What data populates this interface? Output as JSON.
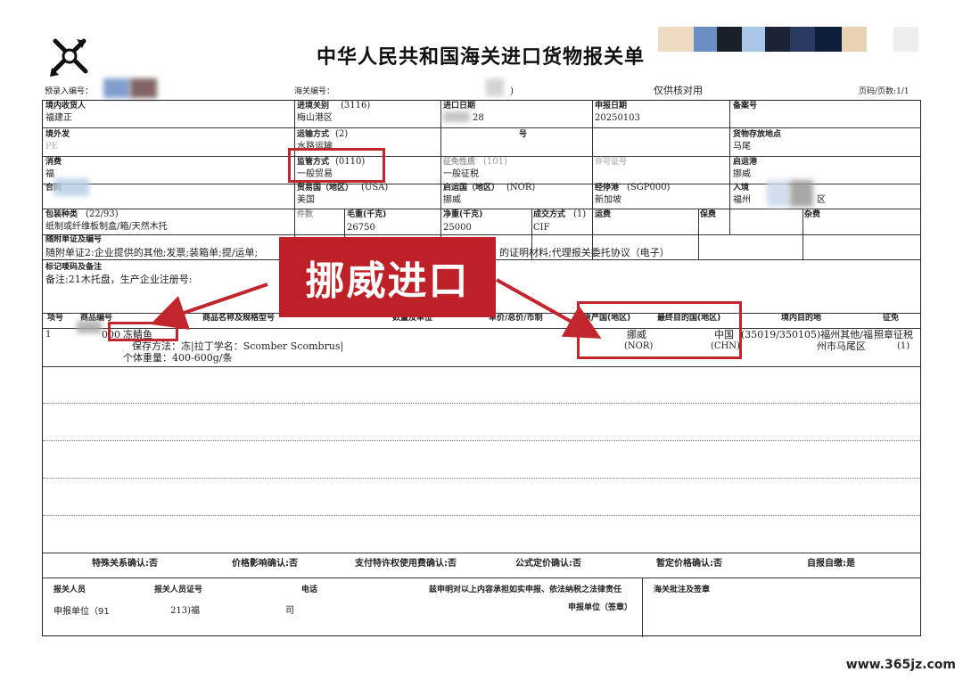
{
  "doc": {
    "title": "中华人民共和国海关进口货物报关单",
    "pre_entry_label": "预录入编号：",
    "customs_no_label": "海关编号：",
    "customs_no_tail": ")",
    "reference": "仅供核对用",
    "page": "页码/页数:1/1"
  },
  "row1": {
    "consignee_label": "境内收货人",
    "consignee_value": "福建正",
    "port_label": "进境关别",
    "port_code": "(3116)",
    "port_value": "梅山港区",
    "import_date_label": "进口日期",
    "import_date_value": "28",
    "declare_date_label": "申报日期",
    "declare_date_value": "20250103",
    "filing_label": "备案号"
  },
  "row2": {
    "shipper_label": "境外发",
    "shipper_value": "PE",
    "transport_label": "运输方式",
    "transport_code": "(2)",
    "transport_value": "水路运输",
    "voyage_label": "号",
    "storage_label": "货物存放地点",
    "storage_value": "马尾"
  },
  "row3": {
    "consumer_label": "消费",
    "consumer_value": "福",
    "supervision_label": "监管方式",
    "supervision_code": "(0110)",
    "supervision_value": "一般贸易",
    "levy_label": "征免性质",
    "levy_code": "(101)",
    "levy_value": "一般征税",
    "license_label": "许可证号",
    "departure_label": "启运港",
    "departure_value": "挪威"
  },
  "row4": {
    "contract_label": "合同",
    "trade_country_label": "贸易国（地区）",
    "trade_country_code": "(USA)",
    "trade_country_value": "美国",
    "origin_country_label": "启运国（地区）",
    "origin_country_code": "(NOR)",
    "origin_country_value": "挪威",
    "transit_label": "经停港",
    "transit_code": "(SGP000)",
    "transit_value": "新加坡",
    "entry_label": "入境",
    "entry_value": "福州",
    "entry_tail": "区"
  },
  "row5": {
    "package_label": "包装种类",
    "package_code": "(22/93)",
    "package_value": "纸制或纤维板制盒/箱/天然木托",
    "pieces_label": "件数",
    "gross_label": "毛重(千克)",
    "gross_value": "26750",
    "net_label": "净重(千克)",
    "net_value": "25000",
    "terms_label": "成交方式",
    "terms_code": "(1)",
    "terms_value": "CIF",
    "freight_label": "运费",
    "insurance_label": "保费",
    "misc_label": "杂费"
  },
  "docs": {
    "label": "随附单证及编号",
    "value": "随附单证2:企业提供的其他;发票;装箱单;提/运单;",
    "value_tail": "的证明材料;代理报关委托协议（电子）"
  },
  "marks": {
    "label": "标记唛码及备注",
    "value": "备注:21木托盘，生产企业注册号:"
  },
  "items": {
    "headers": [
      "项号",
      "商品编号",
      "商品名称及规格型号",
      "数量及单位",
      "单价/总价/币制",
      "原产国(地区)",
      "最终目的国(地区)",
      "境内目的地",
      "征免"
    ],
    "rows": [
      {
        "no": "1",
        "code": "000",
        "name": "冻鲭鱼",
        "spec1": "保存方法：冻|拉丁学名：Scomber Scombrus|",
        "spec2": "个体重量：400-600g/条",
        "origin": "挪威",
        "origin_code": "(NOR)",
        "dest": "中国",
        "dest_code": "(CHN)",
        "domestic": "(35019/350105)福州其他/福",
        "domestic2": "州市马尾区",
        "levy": "照章征税",
        "levy_code": "(1)"
      }
    ]
  },
  "confirm": {
    "special": "特殊关系确认:否",
    "price": "价格影响确认:否",
    "royalty": "支付特许权使用费确认:否",
    "formula": "公式定价确认:否",
    "provisional": "暂定价格确认:否",
    "self": "自报自缴:是"
  },
  "footer": {
    "declarant": "报关人员",
    "declarant_id": "报关人员证号",
    "phone": "电话",
    "statement": "兹申明对以上内容承担如实申报、依法纳税之法律责任",
    "customs_sign": "海关批注及签章",
    "unit_label": "申报单位（91",
    "unit_mid": "213)福",
    "unit_tail": "司",
    "unit_sign": "申报单位（签章）"
  },
  "annotation": {
    "callout": "挪威进口"
  },
  "watermark": "www.365jz.com",
  "colors": {
    "accent_red": "#c0262c",
    "callout_bg": "#bd2127"
  }
}
